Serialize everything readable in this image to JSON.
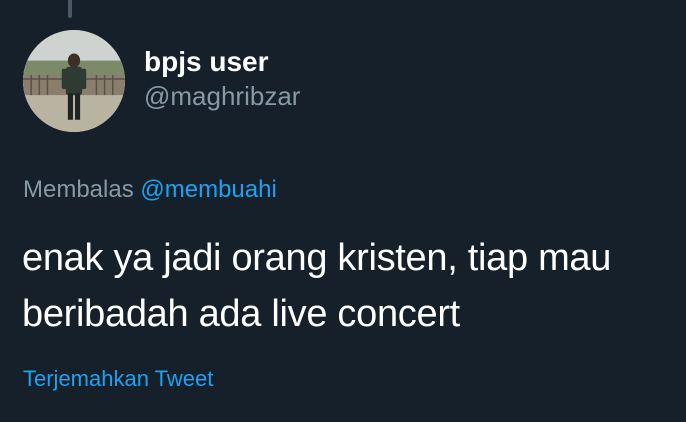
{
  "tweet": {
    "user": {
      "display_name": "bpjs user",
      "handle": "@maghribzar"
    },
    "reply": {
      "prefix": "Membalas",
      "mention": "@membuahi"
    },
    "text": "enak ya jadi orang kristen, tiap mau beribadah ada live concert",
    "translate_label": "Terjemahkan Tweet"
  },
  "colors": {
    "background": "#15202b",
    "accent": "#1da1f2",
    "secondary_text": "#8899a6",
    "primary_text": "#ffffff"
  },
  "icons": {
    "avatar": "profile-photo"
  }
}
